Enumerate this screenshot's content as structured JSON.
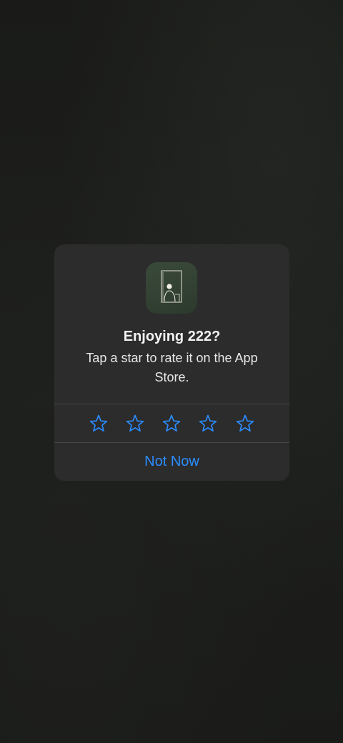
{
  "alert": {
    "app_icon": "person-in-doorway-icon",
    "title": "Enjoying 222?",
    "message": "Tap a star to rate it on the App Store.",
    "stars": [
      {
        "icon": "star-outline-icon"
      },
      {
        "icon": "star-outline-icon"
      },
      {
        "icon": "star-outline-icon"
      },
      {
        "icon": "star-outline-icon"
      },
      {
        "icon": "star-outline-icon"
      }
    ],
    "not_now_label": "Not Now"
  },
  "colors": {
    "accent": "#2a8cff",
    "alert_background": "#2c2c2c",
    "screen_background": "#1b1c1a"
  }
}
